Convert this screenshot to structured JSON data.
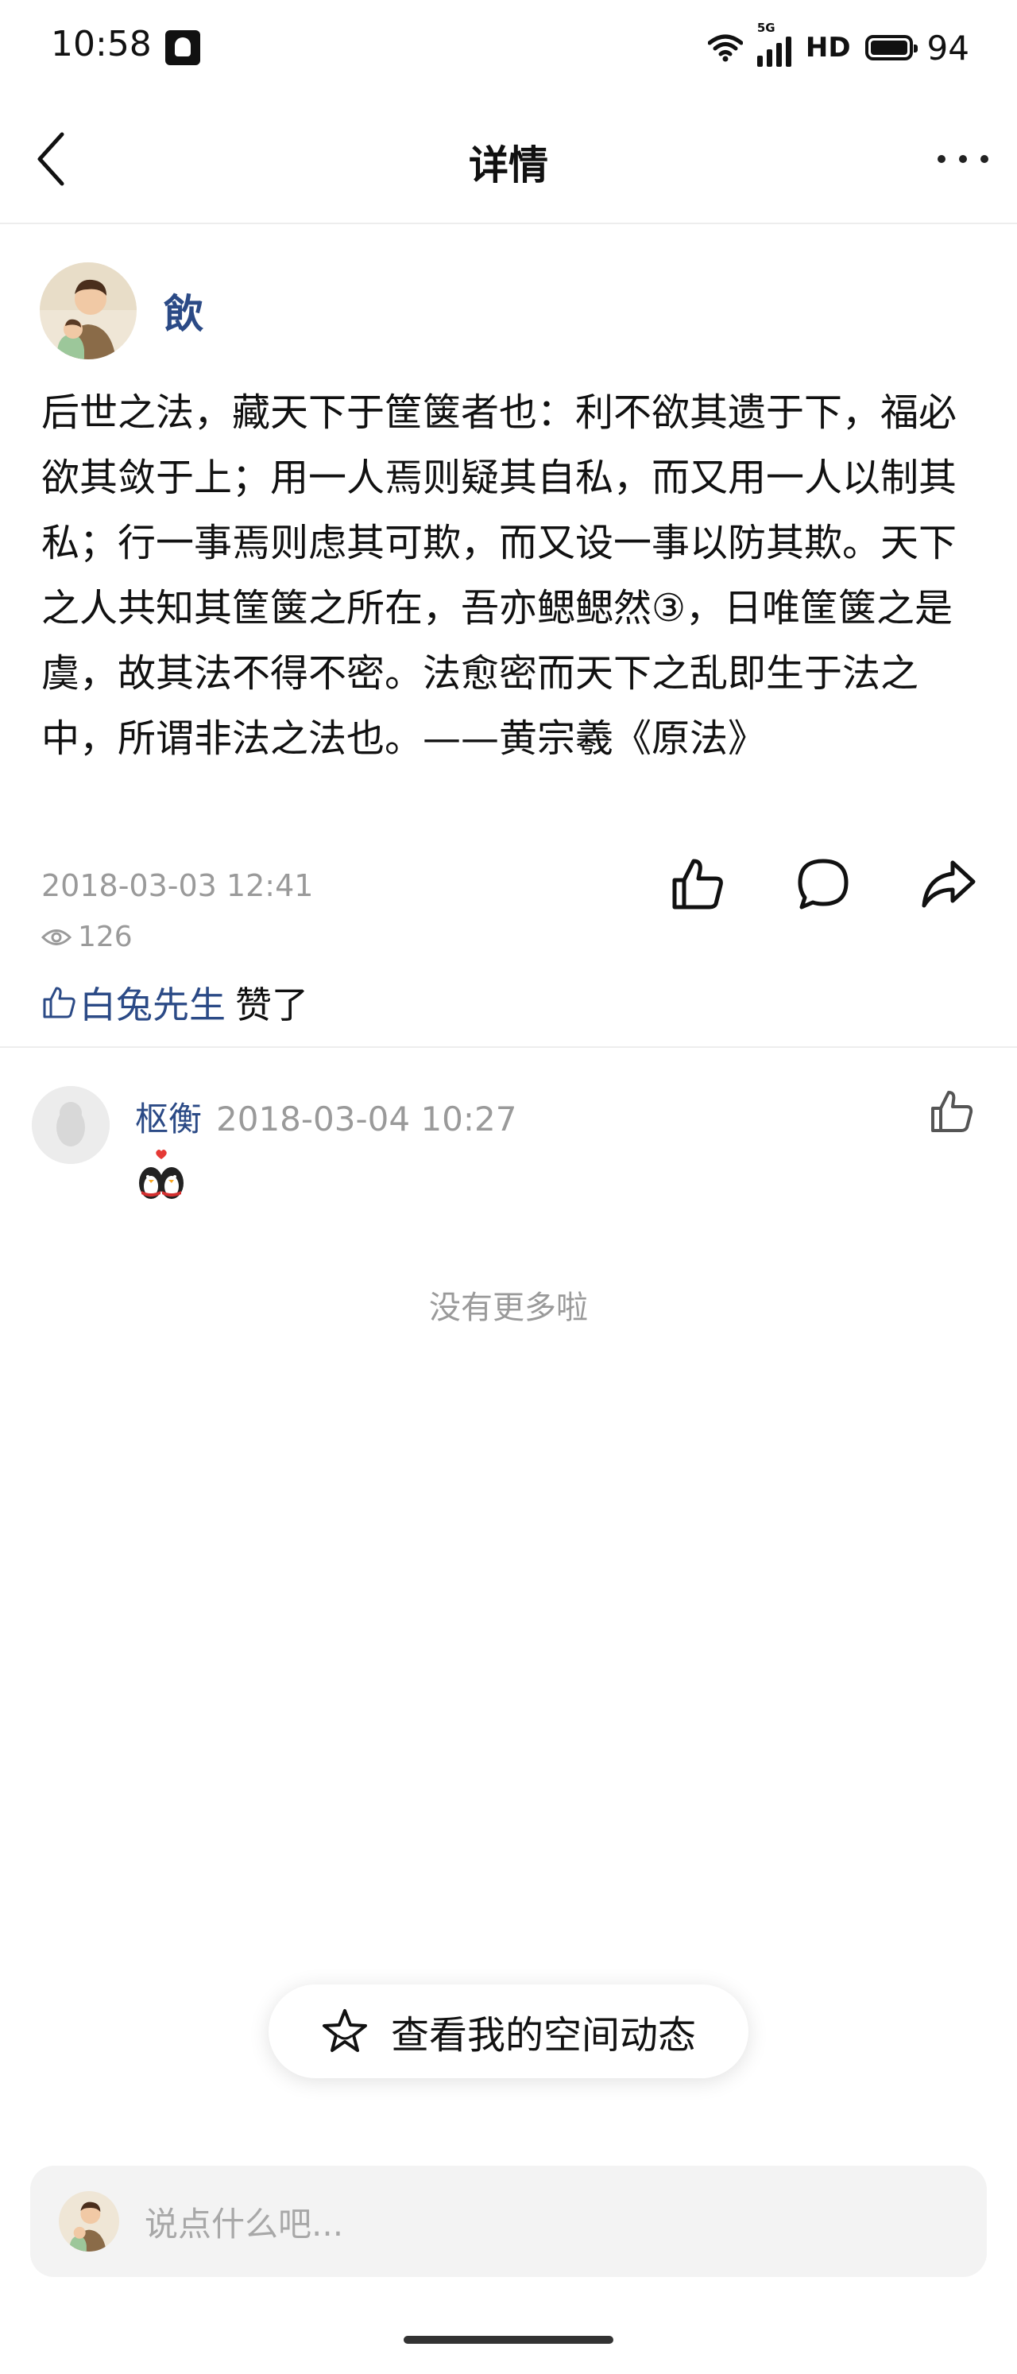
{
  "status_bar": {
    "time": "10:58",
    "network": "5G",
    "hd": "HD",
    "battery": "94"
  },
  "nav": {
    "title": "详情",
    "back_icon": "chevron-left-icon",
    "more_icon": "more-dots-icon"
  },
  "post": {
    "author": "飲",
    "body": "后世之法，藏天下于筐箧者也：利不欲其遗于下，福必欲其敛于上；用一人焉则疑其自私，而又用一人以制其私；行一事焉则虑其可欺，而又设一事以防其欺。天下之人共知其筐箧之所在，吾亦鳃鳃然③，日唯筐箧之是虞，故其法不得不密。法愈密而天下之乱即生于法之中，所谓非法之法也。——黄宗羲《原法》",
    "time": "2018-03-03 12:41",
    "views": "126",
    "liked_by": "白兔先生",
    "liked_suffix": "赞了"
  },
  "comments": [
    {
      "user": "枢衡",
      "time": "2018-03-04 10:27",
      "content_icon": "penguin-couple-emoji"
    }
  ],
  "no_more": "没有更多啦",
  "space_button": {
    "label": "查看我的空间动态",
    "icon": "star-icon"
  },
  "comment_input": {
    "placeholder": "说点什么吧..."
  },
  "colors": {
    "link": "#2b4a86",
    "muted": "#9a9a9a",
    "divider": "#ededed"
  }
}
